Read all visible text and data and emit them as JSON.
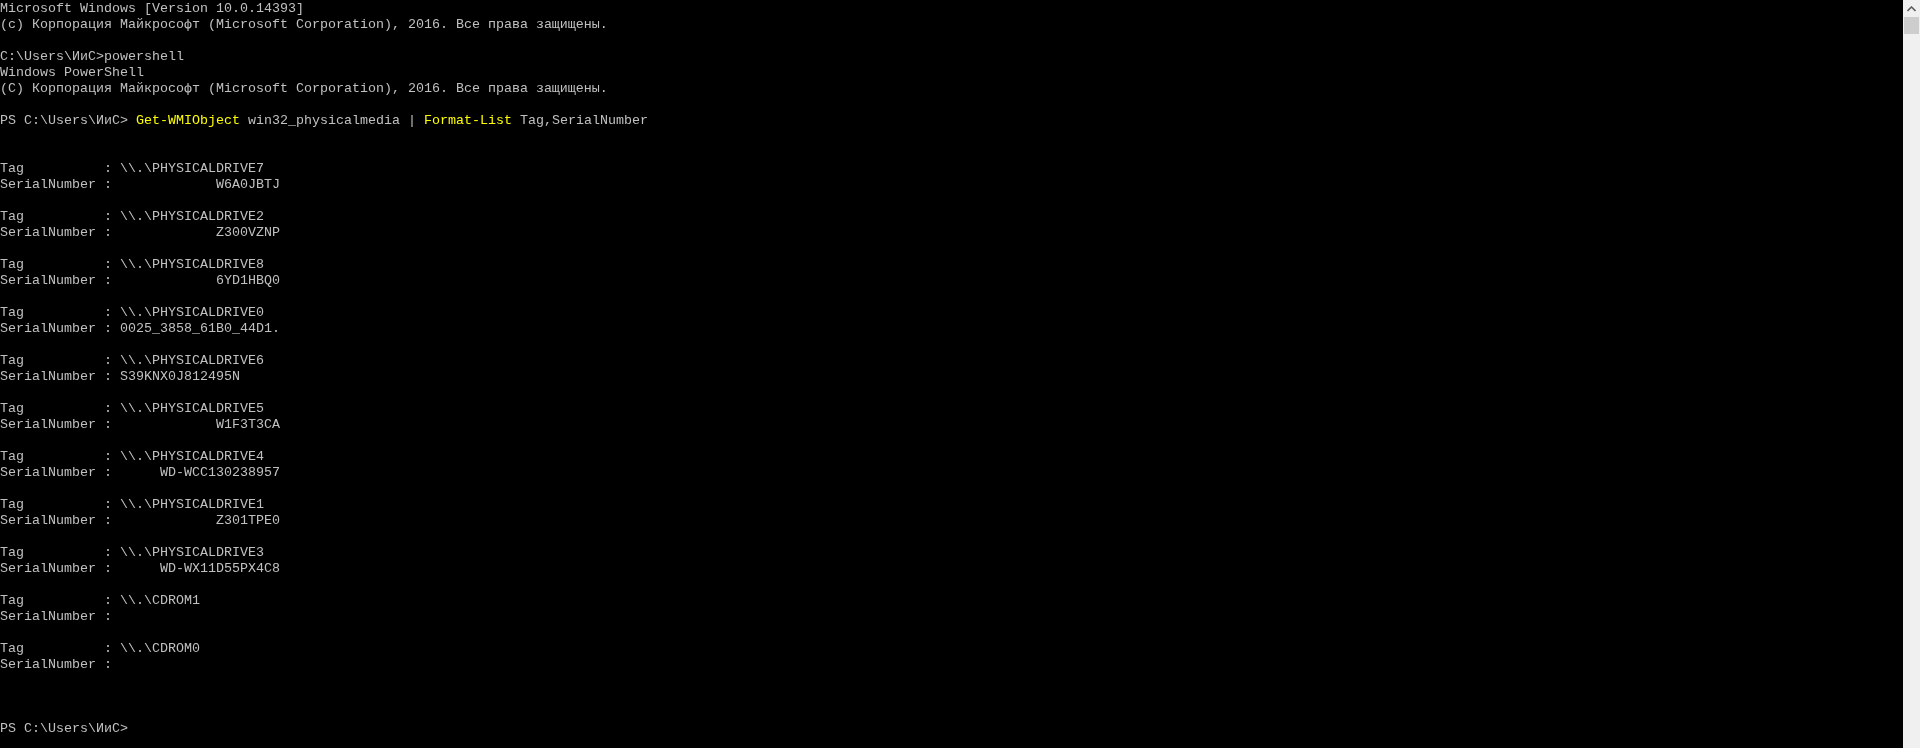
{
  "console": {
    "lines": [
      {
        "kind": "text",
        "text": "Microsoft Windows [Version 10.0.14393]"
      },
      {
        "kind": "text",
        "text": "(c) Корпорация Майкрософт (Microsoft Corporation), 2016. Все права защищены."
      },
      {
        "kind": "blank"
      },
      {
        "kind": "text",
        "text": "C:\\Users\\ИиС>powershell"
      },
      {
        "kind": "text",
        "text": "Windows PowerShell"
      },
      {
        "kind": "text",
        "text": "(C) Корпорация Майкрософт (Microsoft Corporation), 2016. Все права защищены."
      },
      {
        "kind": "blank"
      },
      {
        "kind": "command",
        "segments": [
          {
            "kind": "prompt",
            "text": "PS C:\\Users\\ИиС>"
          },
          {
            "kind": "cmdlet",
            "text": "Get-WMIObject"
          },
          {
            "kind": "argument",
            "text": "win32_physicalmedia"
          },
          {
            "kind": "operator",
            "text": "|"
          },
          {
            "kind": "cmdlet",
            "text": "Format-List"
          },
          {
            "kind": "argument",
            "text": "Tag,SerialNumber"
          }
        ]
      },
      {
        "kind": "blank"
      },
      {
        "kind": "blank"
      },
      {
        "kind": "text",
        "text": "Tag          : \\\\.\\PHYSICALDRIVE7"
      },
      {
        "kind": "text",
        "text": "SerialNumber :             W6A0JBTJ"
      },
      {
        "kind": "blank"
      },
      {
        "kind": "text",
        "text": "Tag          : \\\\.\\PHYSICALDRIVE2"
      },
      {
        "kind": "text",
        "text": "SerialNumber :             Z300VZNP"
      },
      {
        "kind": "blank"
      },
      {
        "kind": "text",
        "text": "Tag          : \\\\.\\PHYSICALDRIVE8"
      },
      {
        "kind": "text",
        "text": "SerialNumber :             6YD1HBQ0"
      },
      {
        "kind": "blank"
      },
      {
        "kind": "text",
        "text": "Tag          : \\\\.\\PHYSICALDRIVE0"
      },
      {
        "kind": "text",
        "text": "SerialNumber : 0025_3858_61B0_44D1."
      },
      {
        "kind": "blank"
      },
      {
        "kind": "text",
        "text": "Tag          : \\\\.\\PHYSICALDRIVE6"
      },
      {
        "kind": "text",
        "text": "SerialNumber : S39KNX0J812495N"
      },
      {
        "kind": "blank"
      },
      {
        "kind": "text",
        "text": "Tag          : \\\\.\\PHYSICALDRIVE5"
      },
      {
        "kind": "text",
        "text": "SerialNumber :             W1F3T3CA"
      },
      {
        "kind": "blank"
      },
      {
        "kind": "text",
        "text": "Tag          : \\\\.\\PHYSICALDRIVE4"
      },
      {
        "kind": "text",
        "text": "SerialNumber :      WD-WCC130238957"
      },
      {
        "kind": "blank"
      },
      {
        "kind": "text",
        "text": "Tag          : \\\\.\\PHYSICALDRIVE1"
      },
      {
        "kind": "text",
        "text": "SerialNumber :             Z301TPE0"
      },
      {
        "kind": "blank"
      },
      {
        "kind": "text",
        "text": "Tag          : \\\\.\\PHYSICALDRIVE3"
      },
      {
        "kind": "text",
        "text": "SerialNumber :      WD-WX11D55PX4C8"
      },
      {
        "kind": "blank"
      },
      {
        "kind": "text",
        "text": "Tag          : \\\\.\\CDROM1"
      },
      {
        "kind": "text",
        "text": "SerialNumber :"
      },
      {
        "kind": "blank"
      },
      {
        "kind": "text",
        "text": "Tag          : \\\\.\\CDROM0"
      },
      {
        "kind": "text",
        "text": "SerialNumber :"
      },
      {
        "kind": "blank"
      },
      {
        "kind": "blank"
      },
      {
        "kind": "blank"
      },
      {
        "kind": "text",
        "text": "PS C:\\Users\\ИиС>"
      }
    ]
  }
}
